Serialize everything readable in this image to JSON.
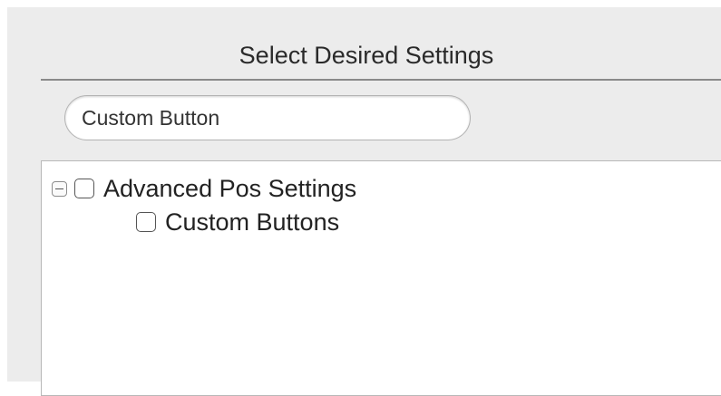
{
  "header": {
    "title": "Select Desired Settings"
  },
  "search": {
    "value": "Custom Button"
  },
  "tree": {
    "nodes": [
      {
        "label": "Advanced Pos Settings",
        "expanded": true,
        "checked": false,
        "children": [
          {
            "label": "Custom Buttons",
            "checked": false
          }
        ]
      }
    ]
  }
}
